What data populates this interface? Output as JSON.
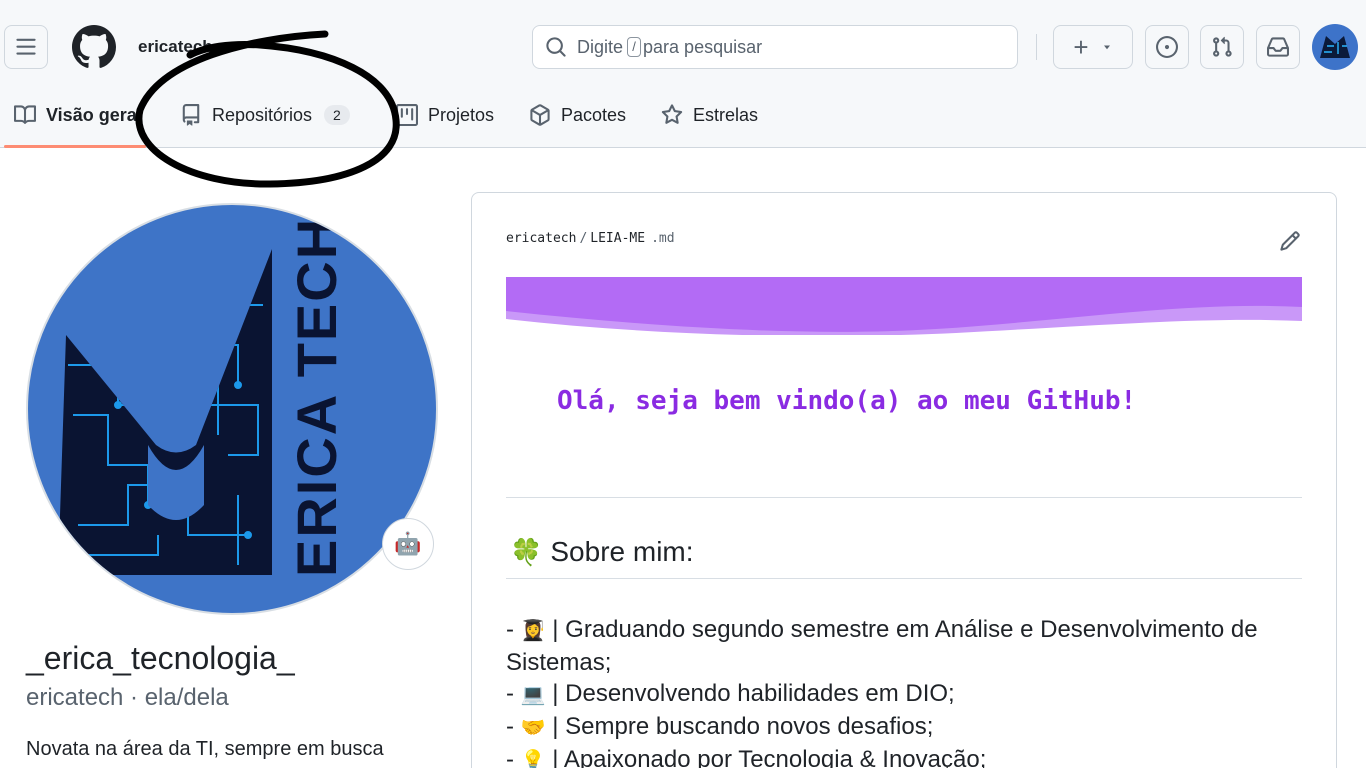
{
  "header": {
    "username": "ericatech",
    "search_placeholder_prefix": "Digite",
    "search_slash_key": "/",
    "search_placeholder_suffix": "para pesquisar",
    "plus_label": "+"
  },
  "tabs": [
    {
      "label": "Visão geral",
      "icon": "book-icon"
    },
    {
      "label": "Repositórios",
      "icon": "repo-icon",
      "count": "2"
    },
    {
      "label": "Projetos",
      "icon": "project-icon"
    },
    {
      "label": "Pacotes",
      "icon": "package-icon"
    },
    {
      "label": "Estrelas",
      "icon": "star-icon"
    }
  ],
  "profile": {
    "avatar_logo_text": "ERICA TECH",
    "status_emoji": "🤖",
    "full_name": "_erica_tecnologia_",
    "handle": "ericatech · ela/dela",
    "bio": "Novata na área da TI, sempre em busca"
  },
  "readme": {
    "owner": "ericatech",
    "separator": "/",
    "filename": "LEIA-ME",
    "extension": ".md",
    "banner_colors": [
      "#b36bf5",
      "#c998f8"
    ],
    "welcome": "Olá, seja bem vindo(a) ao meu GitHub!",
    "welcome_color": "#8a2be2",
    "about_emoji": "🍀",
    "about_title": "Sobre mim:",
    "items": [
      {
        "emoji": "👩‍🎓",
        "text": "| Graduando segundo semestre em Análise e Desenvolvimento de Sistemas;"
      },
      {
        "emoji": "💻",
        "text": "| Desenvolvendo habilidades em DIO;"
      },
      {
        "emoji": "🤝",
        "text": "| Sempre buscando novos desafios;"
      },
      {
        "emoji": "💡",
        "text": "| Apaixonado por Tecnologia & Inovação;"
      }
    ]
  },
  "colors": {
    "accent_underline": "#fd8c73",
    "avatar_blue": "#3e74c7"
  }
}
